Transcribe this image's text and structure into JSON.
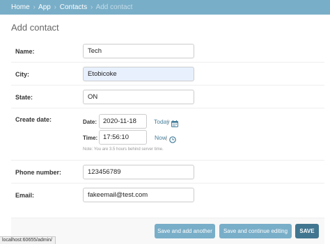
{
  "breadcrumbs": {
    "home": "Home",
    "sep": "›",
    "app": "App",
    "contacts": "Contacts",
    "current": "Add contact"
  },
  "page_title": "Add contact",
  "fields": {
    "name": {
      "label": "Name:",
      "value": "Tech"
    },
    "city": {
      "label": "City:",
      "value": "Etobicoke"
    },
    "state": {
      "label": "State:",
      "value": "ON"
    },
    "create_date": {
      "label": "Create date:",
      "date_label": "Date:",
      "date_value": "2020-11-18",
      "today_link": "Today",
      "date_sep": "|",
      "time_label": "Time:",
      "time_value": "17:56:10",
      "now_link": "Now",
      "time_sep": "|",
      "help_note": "Note: You are 3.5 hours behind server time."
    },
    "phone_number": {
      "label": "Phone number:",
      "value": "123456789"
    },
    "email": {
      "label": "Email:",
      "value": "fakeemail@test.com"
    }
  },
  "actions": {
    "save_add_another": "Save and add another",
    "save_continue": "Save and continue editing",
    "save": "SAVE"
  },
  "status_bar": {
    "url": "localhost:60655/admin/"
  },
  "colors": {
    "header": "#79aec8",
    "link": "#447e9b",
    "primary_button": "#417690",
    "secondary_button": "#79aec8",
    "autofill_background": "#e8f0fe"
  },
  "icons": {
    "calendar": "calendar-icon",
    "clock": "clock-icon"
  }
}
